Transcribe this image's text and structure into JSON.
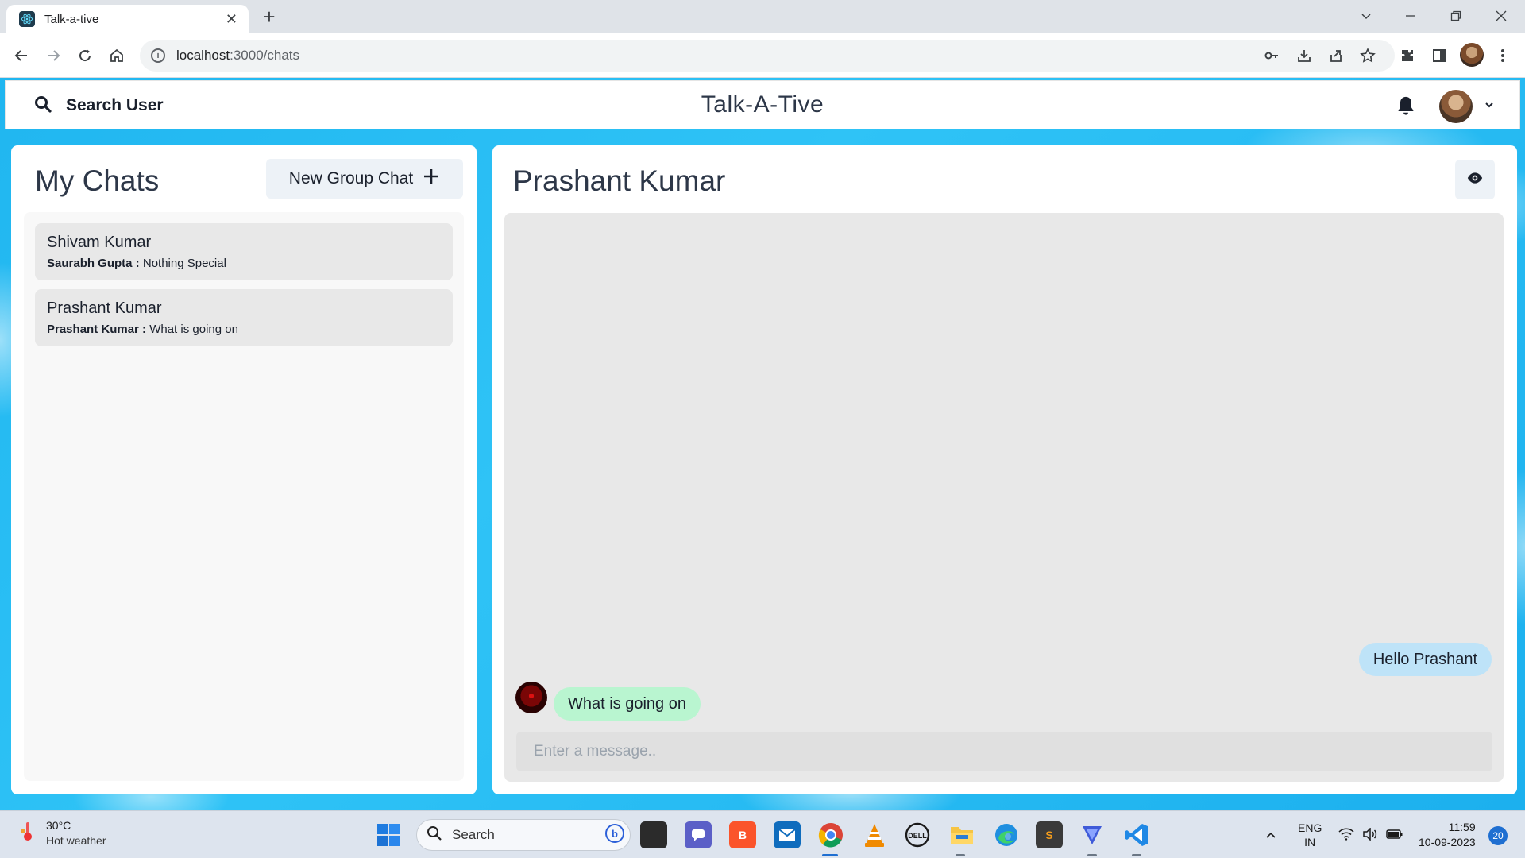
{
  "browser": {
    "tab_title": "Talk-a-tive",
    "url_host": "localhost",
    "url_path": ":3000/chats"
  },
  "app": {
    "search_label": "Search User",
    "brand": "Talk-A-Tive"
  },
  "my_chats": {
    "heading": "My Chats",
    "new_group_label": "New Group Chat",
    "chats": [
      {
        "name": "Shivam Kumar",
        "sender": "Saurabh Gupta :",
        "text": " Nothing Special"
      },
      {
        "name": "Prashant Kumar",
        "sender": "Prashant Kumar :",
        "text": " What is going on"
      }
    ]
  },
  "chat": {
    "title": "Prashant Kumar",
    "messages": [
      {
        "direction": "out",
        "text": "Hello Prashant",
        "color": "#bee3f8"
      },
      {
        "direction": "in",
        "text": "What is going on",
        "color": "#b9f5d0"
      }
    ],
    "input_placeholder": "Enter a message.."
  },
  "taskbar": {
    "temperature": "30°C",
    "weather": "Hot weather",
    "search_label": "Search",
    "lang": "ENG",
    "region": "IN",
    "time": "11:59",
    "date": "10-09-2023",
    "notification_count": "20"
  },
  "colors": {
    "background": "#2fc3f6",
    "bubble_out": "#bee3f8",
    "bubble_in": "#b9f5d0"
  }
}
